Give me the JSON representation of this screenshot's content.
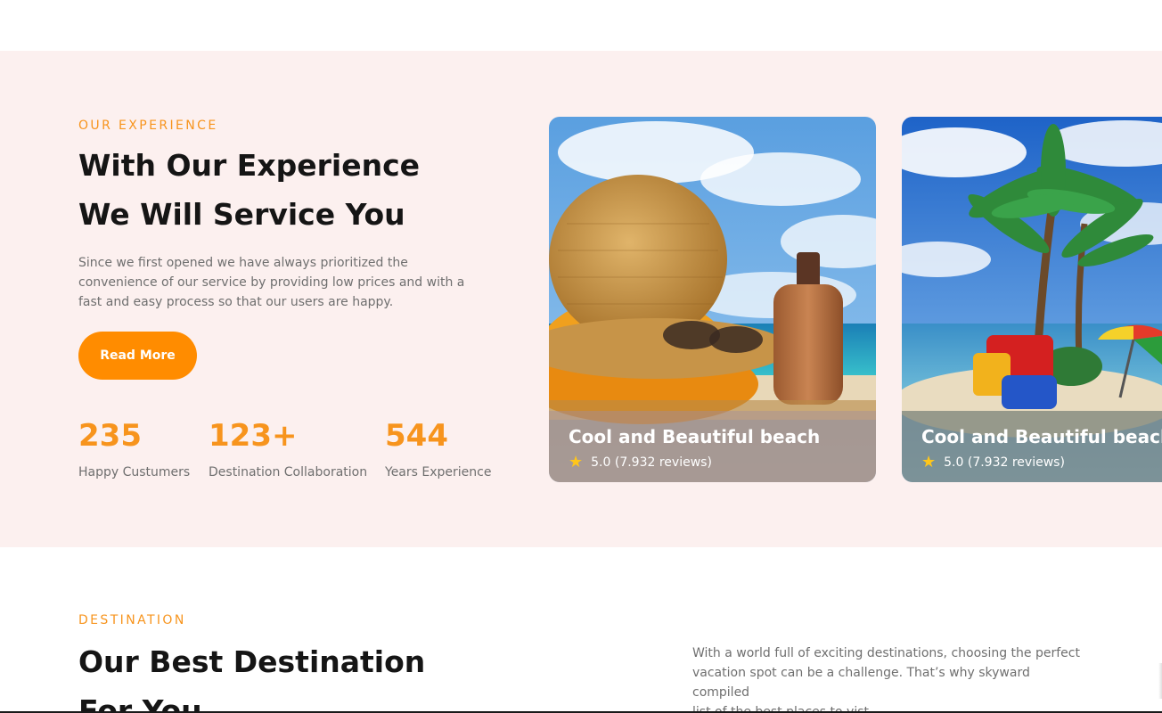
{
  "experience": {
    "eyebrow": "OUR EXPERIENCE",
    "title_line1": "With Our Experience",
    "title_line2": "We Will Service You",
    "paragraph_line1": "Since we first opened we have always prioritized the",
    "paragraph_line2": "convenience of our service by providing low prices and with a",
    "paragraph_line3": "fast and easy process so that our users are happy.",
    "button_label": "Read More",
    "stats": [
      {
        "value": "235",
        "label": "Happy Custumers"
      },
      {
        "value": "123+",
        "label": "Destination Collaboration"
      },
      {
        "value": "544",
        "label": "Years Experience"
      }
    ],
    "cards": [
      {
        "title": "Cool and Beautiful beach",
        "rating": "5.0 (7.932 reviews)",
        "icon": "star-icon"
      },
      {
        "title": "Cool and Beautiful beach",
        "rating": "5.0 (7.932 reviews)",
        "icon": "star-icon"
      }
    ]
  },
  "destination": {
    "eyebrow": "DESTINATION",
    "title_line1": "Our Best Destination",
    "title_line2": "For You",
    "paragraph_line1": "With a world full of exciting destinations, choosing the perfect",
    "paragraph_line2": "vacation spot can be a challenge. That’s why skyward compiled",
    "paragraph_line3": "list of the best places to vist"
  },
  "colors": {
    "accent": "#f7941d",
    "button": "#ff8c00",
    "section_bg": "#fcf0ef",
    "heading": "#151515",
    "body_text": "#6f6f6f",
    "star": "#ffc61a"
  }
}
